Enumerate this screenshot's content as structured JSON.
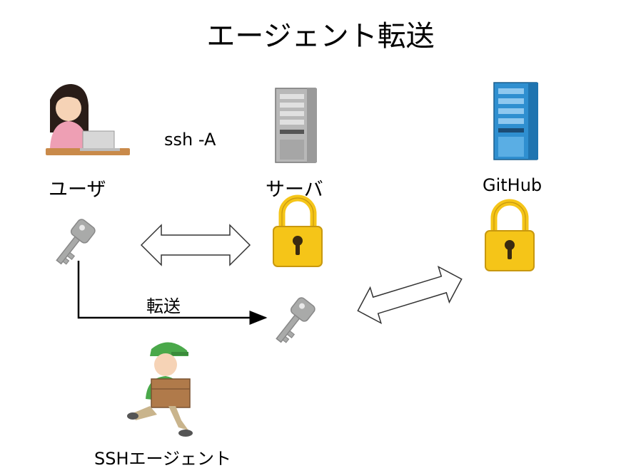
{
  "diagram": {
    "title": "エージェント転送",
    "command_label": "ssh -A",
    "user_label": "ユーザ",
    "server_label": "サーバ",
    "github_label": "GitHub",
    "forward_label": "転送",
    "agent_label": "SSHエージェント"
  },
  "colors": {
    "lock_body": "#f5c518",
    "key": "#a9aaa9",
    "server_gray": "#b8b8b8",
    "github_server_blue": "#2f8fd0",
    "shirt_pink": "#ee9fb4",
    "uniform_green": "#4aa84a"
  }
}
